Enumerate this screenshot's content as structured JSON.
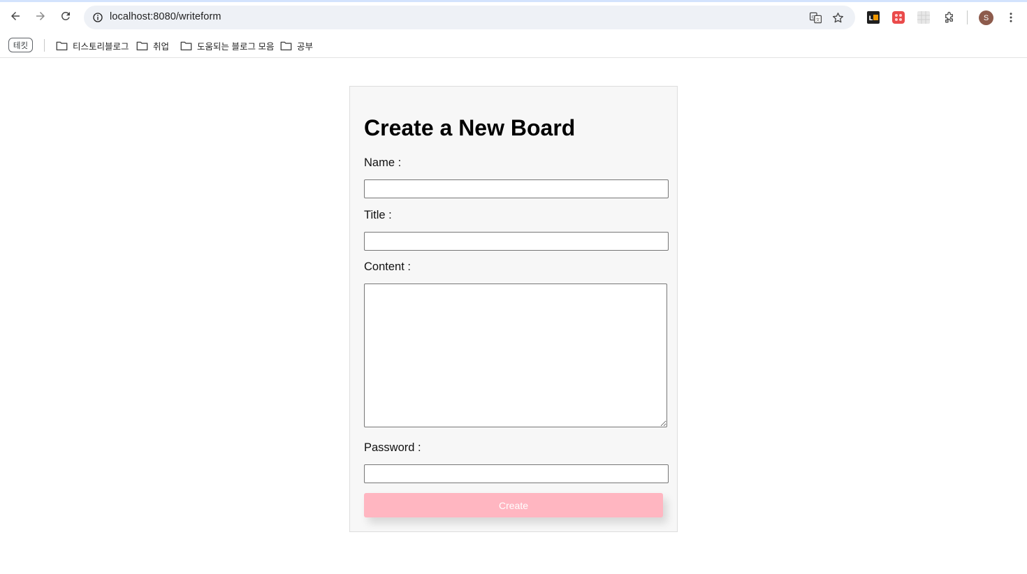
{
  "browser": {
    "url": "localhost:8080/writeform",
    "avatar_letter": "S",
    "bookmark_chip": "테킷",
    "bookmarks": [
      {
        "label": "티스토리블로그",
        "icon": "folder-icon"
      },
      {
        "label": "취업",
        "icon": "folder-icon"
      },
      {
        "label": "도움되는 블로그 모음",
        "icon": "folder-icon"
      },
      {
        "label": "공부",
        "icon": "folder-icon"
      }
    ],
    "extensions": [
      "translate-icon",
      "star-icon",
      "lh-extension-icon",
      "red-extension-icon",
      "grid-extension-icon",
      "puzzle-icon",
      "more-vert-icon"
    ]
  },
  "form": {
    "heading": "Create a New Board",
    "name_label": "Name :",
    "name_value": "",
    "title_label": "Title :",
    "title_value": "",
    "content_label": "Content :",
    "content_value": "",
    "password_label": "Password :",
    "password_value": "",
    "submit_label": "Create",
    "submit_color": "#ffb6c1"
  }
}
